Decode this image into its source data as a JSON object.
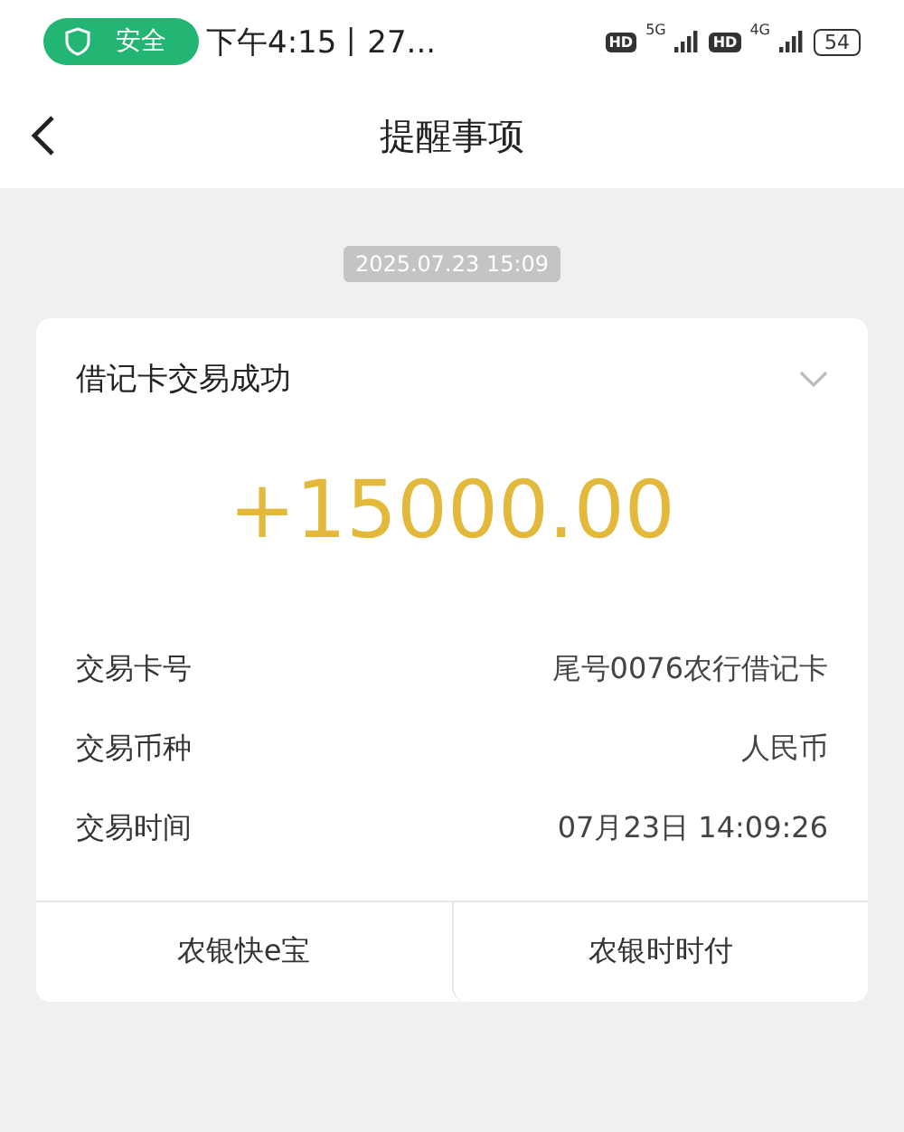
{
  "status_bar": {
    "security_badge": "安全",
    "time": "下午4:15丨27...",
    "sims": [
      {
        "hd": "HD",
        "network": "5G"
      },
      {
        "hd": "HD",
        "network": "4G"
      }
    ],
    "battery": "54"
  },
  "header": {
    "title": "提醒事项"
  },
  "timestamp": "2025.07.23 15:09",
  "card": {
    "title": "借记卡交易成功",
    "expanded": false,
    "amount": "+15000.00",
    "rows": [
      {
        "label": "交易卡号",
        "value": "尾号0076农行借记卡"
      },
      {
        "label": "交易币种",
        "value": "人民币"
      },
      {
        "label": "交易时间",
        "value": "07月23日 14:09:26"
      }
    ],
    "actions": [
      "农银快e宝",
      "农银时时付"
    ]
  }
}
